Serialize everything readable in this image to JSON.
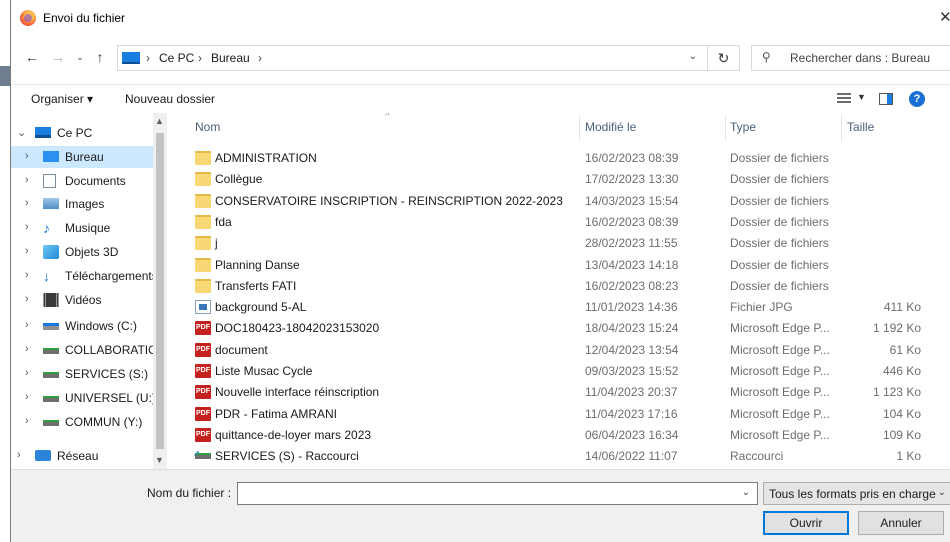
{
  "window": {
    "title": "Envoi du fichier",
    "close_glyph": "✕",
    "icon": "firefox-logo"
  },
  "address": {
    "crumbs": [
      "Ce PC",
      "Bureau"
    ],
    "separator": "›",
    "search_placeholder": "Rechercher dans : Bureau"
  },
  "toolbar": {
    "organize_label": "Organiser ▾",
    "new_folder_label": "Nouveau dossier",
    "help_label": "?"
  },
  "nav": {
    "items": [
      {
        "label": "Ce PC",
        "icon": "computer-icon",
        "expanded": true
      },
      {
        "label": "Bureau",
        "icon": "desktop-icon",
        "selected": true
      },
      {
        "label": "Documents",
        "icon": "documents-icon"
      },
      {
        "label": "Images",
        "icon": "images-icon"
      },
      {
        "label": "Musique",
        "icon": "music-icon"
      },
      {
        "label": "Objets 3D",
        "icon": "3d-objects-icon"
      },
      {
        "label": "Téléchargements",
        "icon": "downloads-icon"
      },
      {
        "label": "Vidéos",
        "icon": "videos-icon"
      },
      {
        "label": "Windows (C:)",
        "icon": "windows-drive-icon"
      },
      {
        "label": "COLLABORATIO",
        "icon": "network-drive-icon"
      },
      {
        "label": "SERVICES (S:)",
        "icon": "network-drive-icon"
      },
      {
        "label": "UNIVERSEL (U:)",
        "icon": "network-drive-icon"
      },
      {
        "label": "COMMUN (Y:)",
        "icon": "network-drive-icon"
      },
      {
        "label": "Réseau",
        "icon": "network-icon"
      }
    ]
  },
  "columns": {
    "name": "Nom",
    "modified": "Modifié le",
    "type": "Type",
    "size": "Taille"
  },
  "files": [
    {
      "name": "ADMINISTRATION",
      "modified": "16/02/2023 08:39",
      "type": "Dossier de fichiers",
      "size": "",
      "kind": "folder"
    },
    {
      "name": "Collègue",
      "modified": "17/02/2023 13:30",
      "type": "Dossier de fichiers",
      "size": "",
      "kind": "folder"
    },
    {
      "name": "CONSERVATOIRE INSCRIPTION - REINSCRIPTION 2022-2023",
      "modified": "14/03/2023 15:54",
      "type": "Dossier de fichiers",
      "size": "",
      "kind": "folder"
    },
    {
      "name": "fda",
      "modified": "16/02/2023 08:39",
      "type": "Dossier de fichiers",
      "size": "",
      "kind": "folder"
    },
    {
      "name": "j",
      "modified": "28/02/2023 11:55",
      "type": "Dossier de fichiers",
      "size": "",
      "kind": "folder"
    },
    {
      "name": "Planning Danse",
      "modified": "13/04/2023 14:18",
      "type": "Dossier de fichiers",
      "size": "",
      "kind": "folder"
    },
    {
      "name": "Transferts FATI",
      "modified": "16/02/2023 08:23",
      "type": "Dossier de fichiers",
      "size": "",
      "kind": "folder"
    },
    {
      "name": "background 5-AL",
      "modified": "11/01/2023 14:36",
      "type": "Fichier JPG",
      "size": "411 Ko",
      "kind": "image"
    },
    {
      "name": "DOC180423-18042023153020",
      "modified": "18/04/2023 15:24",
      "type": "Microsoft Edge P...",
      "size": "1 192 Ko",
      "kind": "pdf"
    },
    {
      "name": "document",
      "modified": "12/04/2023 13:54",
      "type": "Microsoft Edge P...",
      "size": "61 Ko",
      "kind": "pdf"
    },
    {
      "name": "Liste Musac Cycle",
      "modified": "09/03/2023 15:52",
      "type": "Microsoft Edge P...",
      "size": "446 Ko",
      "kind": "pdf"
    },
    {
      "name": "Nouvelle interface réinscription",
      "modified": "11/04/2023 20:37",
      "type": "Microsoft Edge P...",
      "size": "1 123 Ko",
      "kind": "pdf"
    },
    {
      "name": "PDR - Fatima AMRANI",
      "modified": "11/04/2023 17:16",
      "type": "Microsoft Edge P...",
      "size": "104 Ko",
      "kind": "pdf"
    },
    {
      "name": "quittance-de-loyer mars 2023",
      "modified": "06/04/2023 16:34",
      "type": "Microsoft Edge P...",
      "size": "109 Ko",
      "kind": "pdf"
    },
    {
      "name": "SERVICES (S) - Raccourci",
      "modified": "14/06/2022 11:07",
      "type": "Raccourci",
      "size": "1 Ko",
      "kind": "shortcut"
    }
  ],
  "footer": {
    "filename_label": "Nom du fichier :",
    "filename_value": "",
    "filter_value": "Tous les formats pris en charge",
    "open_label": "Ouvrir",
    "cancel_label": "Annuler"
  },
  "colors": {
    "selection": "#cce8ff",
    "accent": "#0078d7",
    "folder": "#f8d775",
    "pdf": "#c5221f"
  }
}
